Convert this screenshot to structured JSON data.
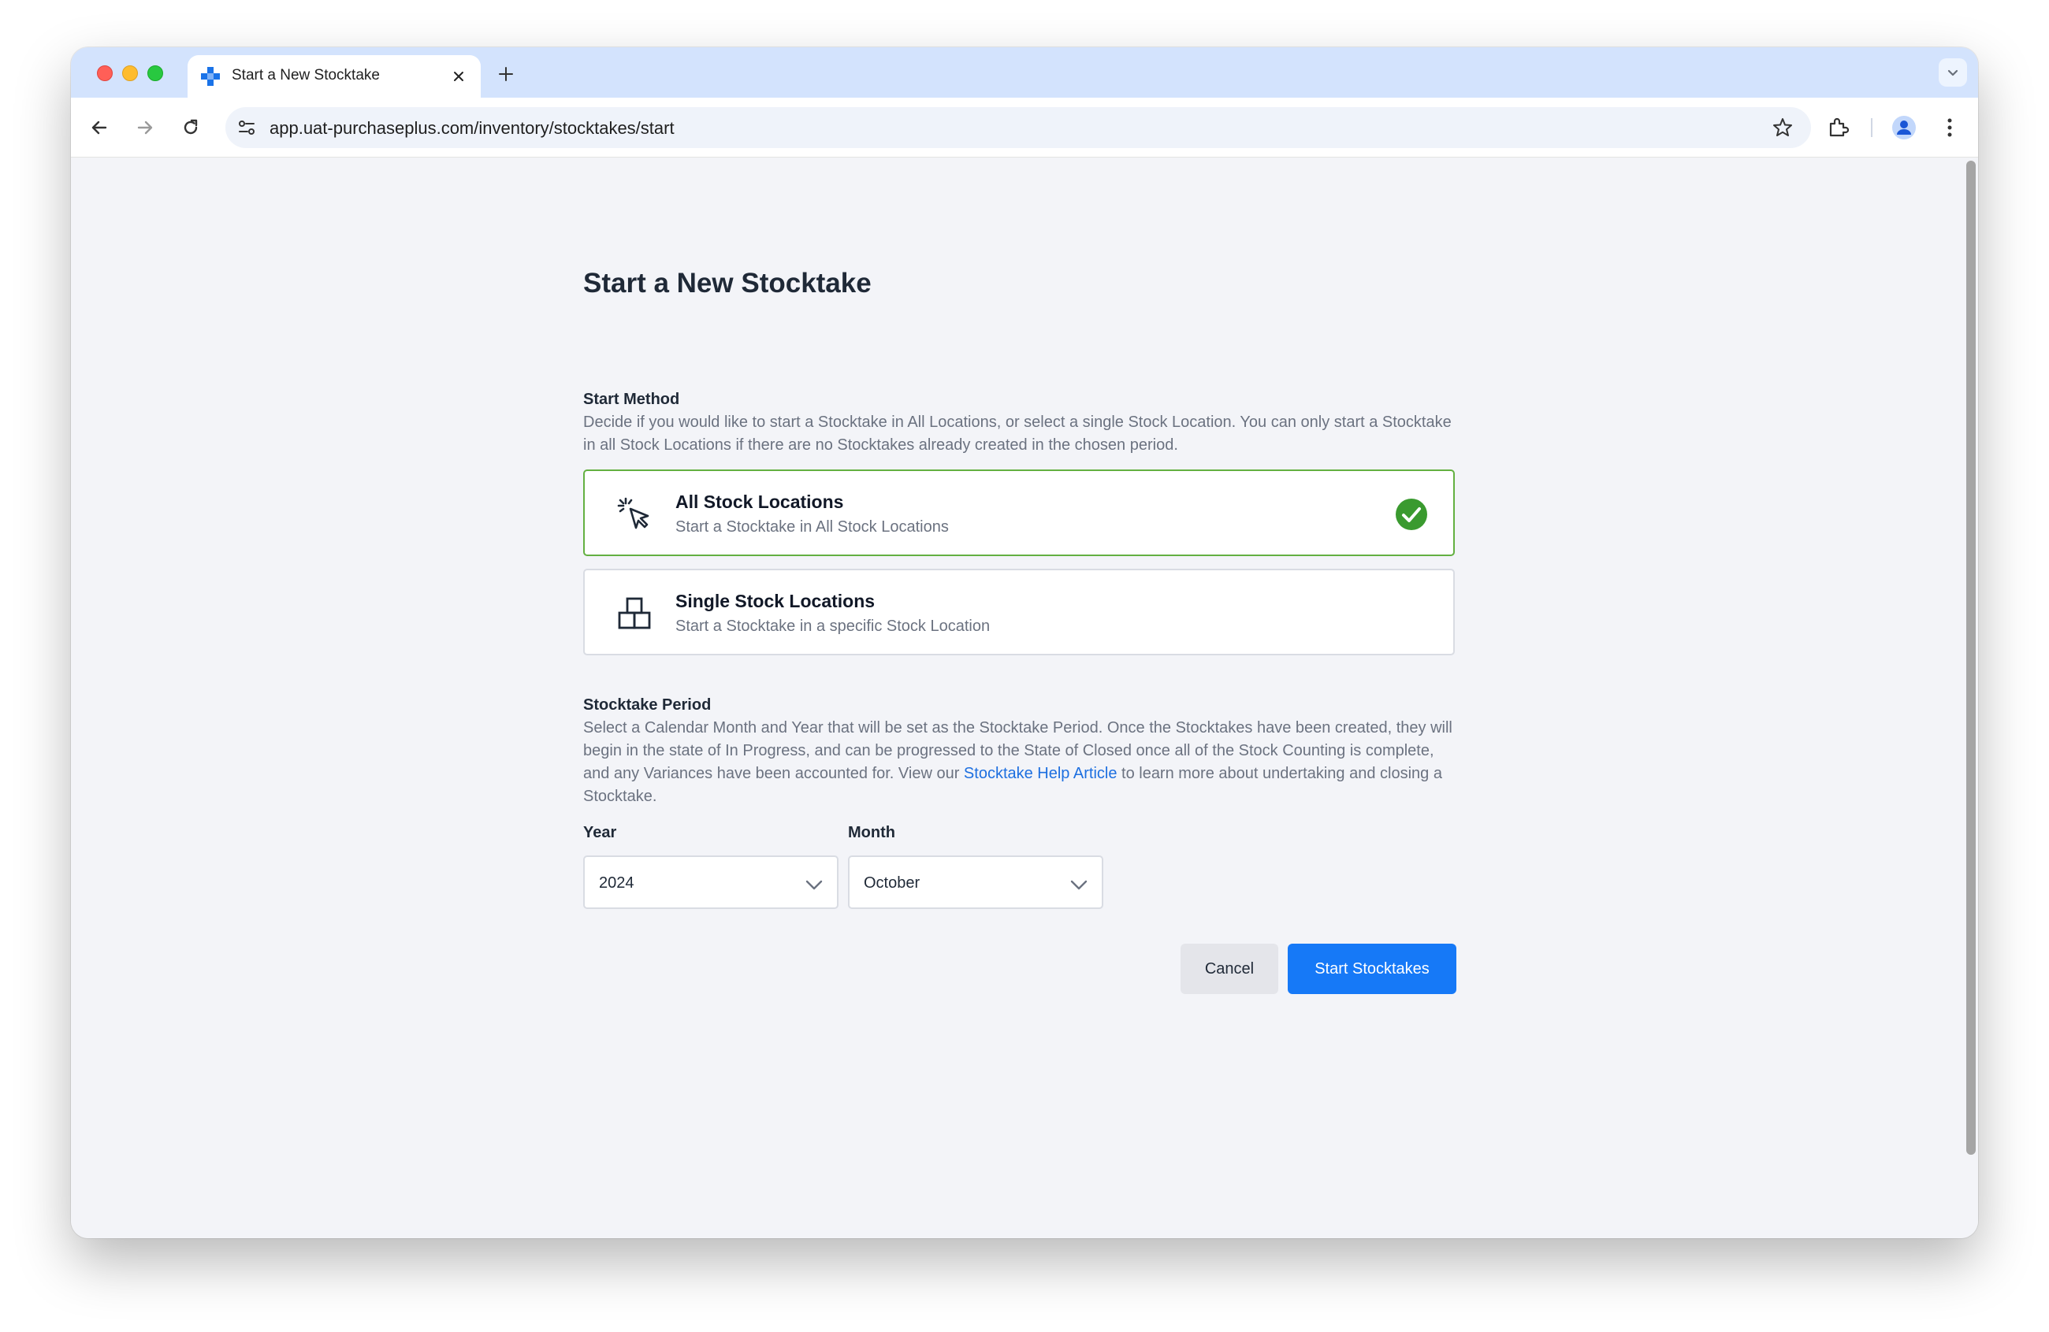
{
  "browser": {
    "tab_title": "Start a New Stocktake",
    "url": "app.uat-purchaseplus.com/inventory/stocktakes/start"
  },
  "page": {
    "title": "Start a New Stocktake",
    "start_method": {
      "label": "Start Method",
      "description": "Decide if you would like to start a Stocktake in All Locations, or select a single Stock Location. You can only start a Stocktake in all Stock Locations if there are no Stocktakes already created in the chosen period.",
      "options": [
        {
          "title": "All Stock Locations",
          "subtitle": "Start a Stocktake in All Stock Locations",
          "selected": true,
          "icon": "cursor-click-icon"
        },
        {
          "title": "Single Stock Locations",
          "subtitle": "Start a Stocktake in a specific Stock Location",
          "selected": false,
          "icon": "boxes-icon"
        }
      ]
    },
    "period": {
      "label": "Stocktake Period",
      "description_before_link": "Select a Calendar Month and Year that will be set as the Stocktake Period. Once the Stocktakes have been created, they will begin in the state of In Progress, and can be progressed to the State of Closed once all of the Stock Counting is complete, and any Variances have been accounted for. View our ",
      "link_text": "Stocktake Help Article",
      "description_after_link": " to learn more about undertaking and closing a Stocktake.",
      "year_label": "Year",
      "year_value": "2024",
      "month_label": "Month",
      "month_value": "October"
    },
    "actions": {
      "cancel_label": "Cancel",
      "start_label": "Start Stocktakes"
    }
  },
  "colors": {
    "selected_border": "#63b041",
    "check_green": "#3a9a2f",
    "primary_button": "#1679f7",
    "link": "#1d6fe0"
  }
}
